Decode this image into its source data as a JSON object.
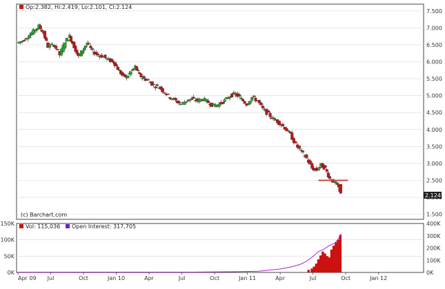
{
  "header": {
    "ohlc_text": "Op:2.382, Hi:2.419, Lo:2.101, Cl:2.124",
    "last_price_label": "2.124"
  },
  "watermark": "(c) Barchart.com",
  "volume_legend": {
    "vol_text": "Vol: 115,036",
    "oi_text": "Open Interest: 317,705"
  },
  "colors": {
    "up": "#22aa22",
    "down": "#cc1111",
    "volume": "#cc1111",
    "open_interest": "#aa22cc",
    "support_line": "#cc4444",
    "grid": "#d8d8d8",
    "frame": "#444444"
  },
  "chart_data": [
    {
      "type": "candlestick",
      "price_axis": {
        "ticks": [
          "7.500",
          "7.000",
          "6.500",
          "6.000",
          "5.500",
          "5.000",
          "4.500",
          "4.000",
          "3.500",
          "3.000",
          "2.500",
          "2.000",
          "1.500"
        ],
        "ylim": [
          1.35,
          7.7
        ]
      },
      "x_axis": {
        "ticks": [
          "Apr 09",
          "Jul",
          "Oct",
          "Jan 10",
          "Apr",
          "Jul",
          "Oct",
          "Jan 11",
          "Apr",
          "Jul",
          "Oct",
          "Jan 12"
        ],
        "month_range": [
          0,
          37
        ]
      },
      "horizontal_line": 2.5,
      "series_close_points": [
        [
          0,
          6.55
        ],
        [
          0.5,
          6.62
        ],
        [
          1,
          6.75
        ],
        [
          1.5,
          6.9
        ],
        [
          2,
          7.05
        ],
        [
          2.4,
          6.85
        ],
        [
          2.8,
          6.45
        ],
        [
          3.4,
          6.5
        ],
        [
          3.9,
          6.2
        ],
        [
          4.4,
          6.6
        ],
        [
          4.8,
          6.75
        ],
        [
          5.2,
          6.45
        ],
        [
          5.6,
          6.15
        ],
        [
          6,
          6.35
        ],
        [
          6.4,
          6.55
        ],
        [
          6.9,
          6.3
        ],
        [
          7.4,
          6.2
        ],
        [
          7.9,
          6.15
        ],
        [
          8.4,
          6.05
        ],
        [
          8.8,
          6.0
        ],
        [
          9.2,
          5.8
        ],
        [
          9.6,
          5.6
        ],
        [
          10,
          5.55
        ],
        [
          10.4,
          5.7
        ],
        [
          10.8,
          5.85
        ],
        [
          11.2,
          5.6
        ],
        [
          11.6,
          5.5
        ],
        [
          12,
          5.45
        ],
        [
          12.5,
          5.3
        ],
        [
          13,
          5.25
        ],
        [
          13.5,
          5.1
        ],
        [
          14,
          4.95
        ],
        [
          14.5,
          4.85
        ],
        [
          15,
          4.75
        ],
        [
          15.5,
          4.85
        ],
        [
          16,
          4.9
        ],
        [
          16.5,
          4.85
        ],
        [
          17,
          4.9
        ],
        [
          17.5,
          4.8
        ],
        [
          18,
          4.7
        ],
        [
          18.5,
          4.75
        ],
        [
          19,
          4.85
        ],
        [
          19.5,
          5.0
        ],
        [
          20,
          5.05
        ],
        [
          20.5,
          4.9
        ],
        [
          21,
          4.75
        ],
        [
          21.5,
          4.95
        ],
        [
          22,
          4.85
        ],
        [
          22.5,
          4.6
        ],
        [
          23,
          4.45
        ],
        [
          23.5,
          4.3
        ],
        [
          24,
          4.2
        ],
        [
          24.5,
          4.05
        ],
        [
          25,
          3.85
        ],
        [
          25.5,
          3.55
        ],
        [
          26,
          3.35
        ],
        [
          26.5,
          3.15
        ],
        [
          27,
          2.85
        ],
        [
          27.4,
          2.8
        ],
        [
          27.8,
          2.95
        ],
        [
          28.2,
          2.85
        ],
        [
          28.6,
          2.55
        ],
        [
          29,
          2.45
        ],
        [
          29.3,
          2.35
        ],
        [
          29.6,
          2.124
        ]
      ],
      "last_candle": {
        "open": 2.382,
        "high": 2.419,
        "low": 2.101,
        "close": 2.124
      }
    },
    {
      "type": "bar",
      "volume_axis": {
        "ticks": [
          "150K",
          "100K",
          "50K",
          "0K"
        ],
        "ylim": [
          0,
          150000
        ]
      },
      "open_interest_axis": {
        "ticks": [
          "400K",
          "300K",
          "200K",
          "100K",
          "0K"
        ],
        "ylim": [
          0,
          400000
        ]
      },
      "volume_points": [
        [
          26.6,
          8000
        ],
        [
          26.9,
          12000
        ],
        [
          27.1,
          18000
        ],
        [
          27.3,
          27000
        ],
        [
          27.5,
          40000
        ],
        [
          27.7,
          52000
        ],
        [
          27.9,
          64000
        ],
        [
          28.1,
          58000
        ],
        [
          28.3,
          50000
        ],
        [
          28.5,
          46000
        ],
        [
          28.7,
          70000
        ],
        [
          28.9,
          82000
        ],
        [
          29.1,
          92000
        ],
        [
          29.3,
          100000
        ],
        [
          29.5,
          115036
        ]
      ],
      "open_interest_points": [
        [
          0,
          2000
        ],
        [
          16,
          3000
        ],
        [
          20,
          6000
        ],
        [
          22,
          10000
        ],
        [
          23,
          18000
        ],
        [
          24,
          28000
        ],
        [
          25,
          45000
        ],
        [
          25.8,
          65000
        ],
        [
          26.4,
          90000
        ],
        [
          27,
          130000
        ],
        [
          27.5,
          170000
        ],
        [
          28,
          190000
        ],
        [
          28.5,
          220000
        ],
        [
          29,
          240000
        ],
        [
          29.3,
          270000
        ],
        [
          29.6,
          317705
        ]
      ]
    }
  ]
}
